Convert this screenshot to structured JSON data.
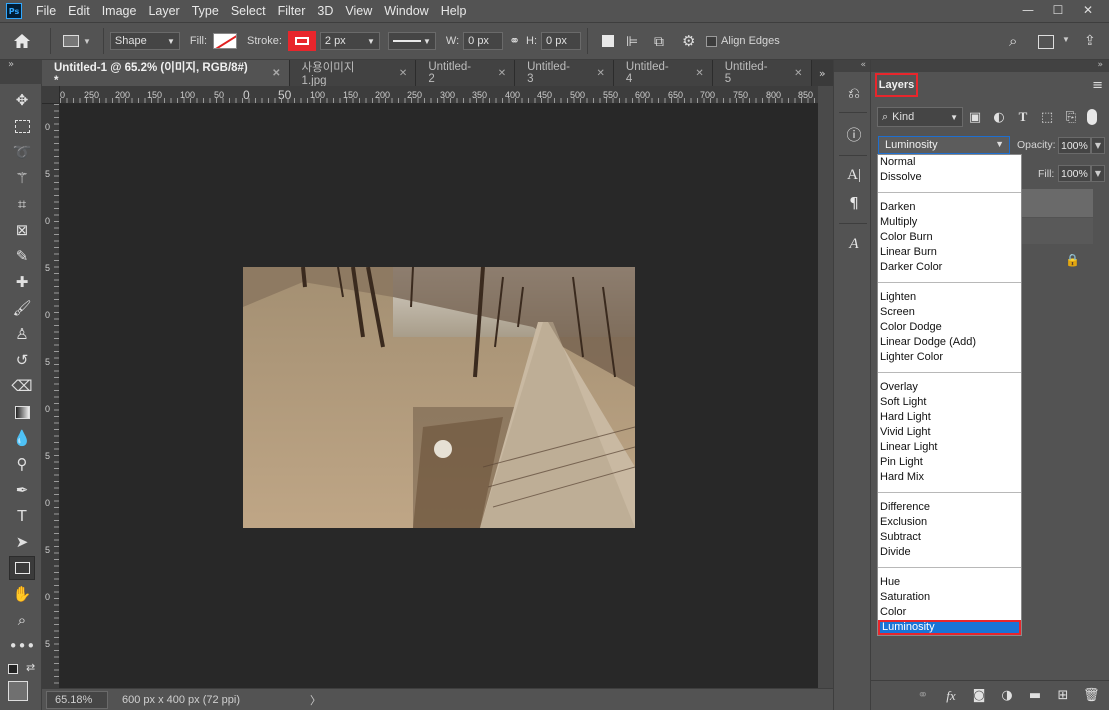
{
  "app": {
    "logo": "Ps"
  },
  "menu": [
    "File",
    "Edit",
    "Image",
    "Layer",
    "Type",
    "Select",
    "Filter",
    "3D",
    "View",
    "Window",
    "Help"
  ],
  "options": {
    "shape_mode": "Shape",
    "fill_label": "Fill:",
    "stroke_label": "Stroke:",
    "stroke_width": "2 px",
    "w_label": "W:",
    "w_value": "0 px",
    "h_label": "H:",
    "h_value": "0 px",
    "align_edges": "Align Edges"
  },
  "tabs": [
    {
      "label": "Untitled-1 @ 65.2% (이미지, RGB/8#) *",
      "active": true
    },
    {
      "label": "사용이미지1.jpg",
      "active": false
    },
    {
      "label": "Untitled-2",
      "active": false
    },
    {
      "label": "Untitled-3",
      "active": false
    },
    {
      "label": "Untitled-4",
      "active": false
    },
    {
      "label": "Untitled-5",
      "active": false
    }
  ],
  "ruler": {
    "marks": [
      "0",
      "250",
      "200",
      "150",
      "100",
      "50",
      "0",
      "50",
      "100",
      "150",
      "200",
      "250",
      "300",
      "350",
      "400",
      "450",
      "500",
      "550",
      "600",
      "650",
      "700",
      "750",
      "800",
      "850"
    ],
    "vertical_marks": [
      "0",
      "5",
      "0",
      "5",
      "0",
      "5",
      "0",
      "5",
      "0",
      "5",
      "0",
      "5"
    ]
  },
  "status": {
    "zoom": "65.18%",
    "doc_info": "600 px x 400 px (72 ppi)"
  },
  "layers_panel": {
    "tab_label": "Layers",
    "kind_label": "Kind",
    "blend_mode": "Luminosity",
    "opacity_label": "Opacity:",
    "opacity_value": "100%",
    "fill_label": "Fill:",
    "fill_value": "100%"
  },
  "blend_modes": {
    "group1": [
      "Normal",
      "Dissolve"
    ],
    "group2": [
      "Darken",
      "Multiply",
      "Color Burn",
      "Linear Burn",
      "Darker Color"
    ],
    "group3": [
      "Lighten",
      "Screen",
      "Color Dodge",
      "Linear Dodge (Add)",
      "Lighter Color"
    ],
    "group4": [
      "Overlay",
      "Soft Light",
      "Hard Light",
      "Vivid Light",
      "Linear Light",
      "Pin Light",
      "Hard Mix"
    ],
    "group5": [
      "Difference",
      "Exclusion",
      "Subtract",
      "Divide"
    ],
    "group6": [
      "Hue",
      "Saturation",
      "Color",
      "Luminosity"
    ],
    "selected": "Luminosity"
  },
  "colors": {
    "highlight": "#e8262c",
    "selection": "#1a74d6"
  }
}
